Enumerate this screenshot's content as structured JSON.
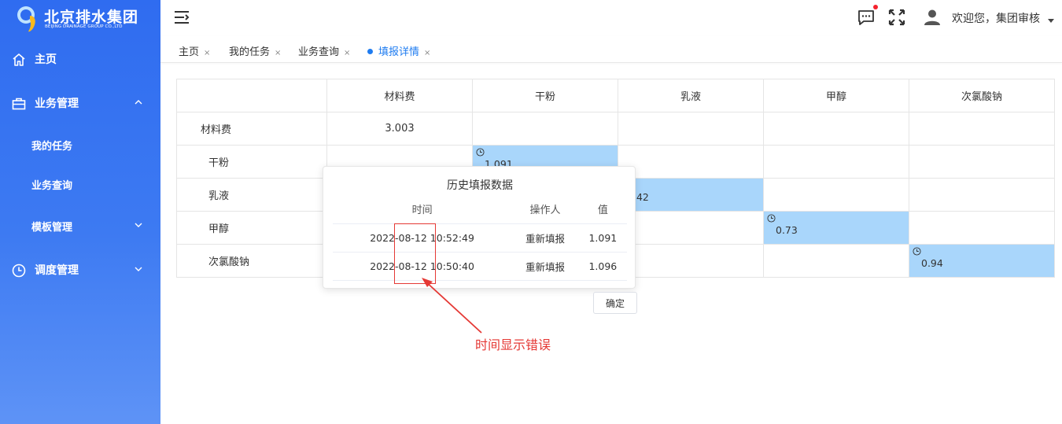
{
  "brand": {
    "name_cn": "北京排水集团",
    "name_en": "BEIJING DRAINAGE GROUP CO.,LTD",
    "primary_color": "#2f6cf0",
    "accent_color": "#1f7cf0",
    "highlight_color": "#a9d6fb",
    "annotation_color": "#e53935"
  },
  "sidebar": {
    "items": [
      {
        "label": "主页",
        "icon": "home-icon"
      },
      {
        "label": "业务管理",
        "icon": "briefcase-icon",
        "expanded": true
      },
      {
        "label": "我的任务"
      },
      {
        "label": "业务查询"
      },
      {
        "label": "模板管理",
        "expanded": false
      },
      {
        "label": "调度管理",
        "icon": "clock-icon",
        "expanded": false
      }
    ]
  },
  "header": {
    "welcome": "欢迎您，集团审核"
  },
  "tabs": [
    {
      "label": "主页",
      "close": "×"
    },
    {
      "label": "我的任务",
      "close": "×"
    },
    {
      "label": "业务查询",
      "close": "×"
    },
    {
      "label": "填报详情",
      "close": "×",
      "active": true
    }
  ],
  "matrix": {
    "columns": [
      "材料费",
      "干粉",
      "乳液",
      "甲醇",
      "次氯酸钠"
    ],
    "rows": [
      {
        "label": "材料费",
        "cells": [
          "3.003",
          "",
          "",
          "",
          ""
        ]
      },
      {
        "label": "干粉",
        "cells": [
          "",
          "1.091",
          "",
          "",
          ""
        ]
      },
      {
        "label": "乳液",
        "cells": [
          "",
          "",
          "242",
          "",
          ""
        ]
      },
      {
        "label": "甲醇",
        "cells": [
          "",
          "",
          "",
          "0.73",
          ""
        ]
      },
      {
        "label": "次氯酸钠",
        "cells": [
          "",
          "",
          "",
          "",
          "0.94"
        ]
      }
    ]
  },
  "popover": {
    "title": "历史填报数据",
    "headers": [
      "时间",
      "操作人",
      "值"
    ],
    "rows": [
      {
        "time": "2022-08-12 10:52:49",
        "operator": "重新填报",
        "value": "1.091"
      },
      {
        "time": "2022-08-12 10:50:40",
        "operator": "重新填报",
        "value": "1.096"
      }
    ]
  },
  "confirm_label": "确定",
  "annotation": {
    "text": "时间显示错误"
  }
}
